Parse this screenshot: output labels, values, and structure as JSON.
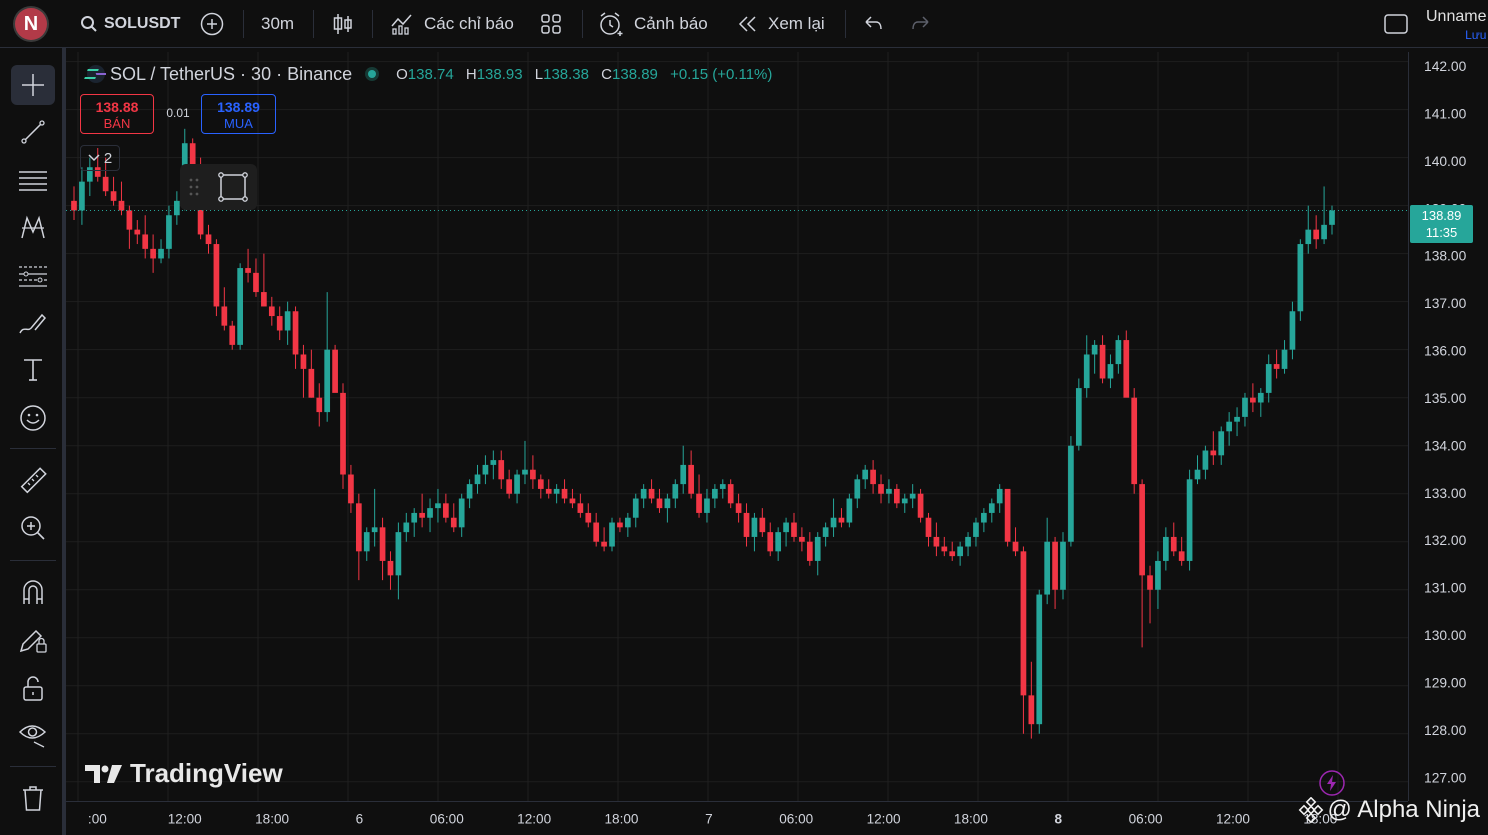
{
  "toolbar": {
    "avatar_letter": "N",
    "symbol": "SOLUSDT",
    "interval": "30m",
    "indicators_label": "Các chỉ báo",
    "alert_label": "Cảnh báo",
    "replay_label": "Xem lại",
    "layout_name": "Unname",
    "save_label": "Lưu"
  },
  "legend": {
    "title": "SOL / TetherUS · 30 · Binance",
    "o_key": "O",
    "o_val": "138.74",
    "h_key": "H",
    "h_val": "138.93",
    "l_key": "L",
    "l_val": "138.38",
    "c_key": "C",
    "c_val": "138.89",
    "change": "+0.15 (+0.11%)"
  },
  "trade": {
    "sell_price": "138.88",
    "sell_label": "BÁN",
    "spread": "0.01",
    "buy_price": "138.89",
    "buy_label": "MUA",
    "indicator_count": "2"
  },
  "current_price": {
    "price": "138.89",
    "countdown": "11:35"
  },
  "watermark": "TradingView",
  "credit": "@ Alpha Ninja",
  "colors": {
    "up": "#26a69a",
    "down": "#f23645",
    "grid": "#1f1f1f",
    "bg": "#0f0f0f"
  },
  "chart_data": {
    "type": "candlestick",
    "title": "SOL / TetherUS · 30 · Binance",
    "ylim": [
      126.6,
      142.2
    ],
    "price_ticks": [
      142,
      141,
      140,
      139,
      138,
      137,
      136,
      135,
      134,
      133,
      132,
      131,
      130,
      129,
      128,
      127
    ],
    "price_tick_labels": [
      "142.00",
      "141.00",
      "140.00",
      "139.00",
      "138.00",
      "137.00",
      "136.00",
      "135.00",
      "134.00",
      "133.00",
      "132.00",
      "131.00",
      "130.00",
      "129.00",
      "128.00",
      "127.00"
    ],
    "time_labels": [
      ":00",
      "12:00",
      "18:00",
      "6",
      "06:00",
      "12:00",
      "18:00",
      "7",
      "06:00",
      "12:00",
      "18:00",
      "8",
      "06:00",
      "12:00",
      "18:00"
    ],
    "time_label_bold": [
      false,
      false,
      false,
      false,
      false,
      false,
      false,
      false,
      false,
      false,
      false,
      true,
      false,
      false,
      false
    ],
    "candles": [
      [
        139.1,
        139.4,
        138.7,
        138.9
      ],
      [
        138.9,
        139.8,
        138.6,
        139.5
      ],
      [
        139.5,
        140.0,
        139.2,
        139.8
      ],
      [
        139.8,
        140.2,
        139.5,
        139.6
      ],
      [
        139.6,
        140.0,
        139.2,
        139.3
      ],
      [
        139.3,
        139.6,
        139.0,
        139.1
      ],
      [
        139.1,
        139.5,
        138.8,
        138.9
      ],
      [
        138.9,
        139.0,
        138.1,
        138.5
      ],
      [
        138.5,
        138.7,
        138.2,
        138.4
      ],
      [
        138.4,
        138.8,
        137.9,
        138.1
      ],
      [
        138.1,
        138.4,
        137.6,
        137.9
      ],
      [
        137.9,
        138.3,
        137.8,
        138.1
      ],
      [
        138.1,
        139.0,
        137.9,
        138.8
      ],
      [
        138.8,
        139.3,
        138.6,
        139.1
      ],
      [
        139.1,
        140.6,
        138.9,
        140.3
      ],
      [
        140.3,
        140.4,
        139.6,
        139.8
      ],
      [
        139.8,
        140.0,
        138.3,
        138.4
      ],
      [
        138.4,
        138.6,
        138.0,
        138.2
      ],
      [
        138.2,
        138.3,
        136.7,
        136.9
      ],
      [
        136.9,
        137.3,
        136.4,
        136.5
      ],
      [
        136.5,
        136.6,
        136.0,
        136.1
      ],
      [
        136.1,
        137.8,
        136.0,
        137.7
      ],
      [
        137.7,
        138.1,
        137.4,
        137.6
      ],
      [
        137.6,
        137.9,
        137.1,
        137.2
      ],
      [
        137.2,
        138.0,
        136.9,
        136.9
      ],
      [
        136.9,
        137.1,
        136.5,
        136.7
      ],
      [
        136.7,
        136.9,
        136.2,
        136.4
      ],
      [
        136.4,
        137.0,
        136.1,
        136.8
      ],
      [
        136.8,
        136.9,
        135.6,
        135.9
      ],
      [
        135.9,
        136.1,
        135.0,
        135.6
      ],
      [
        135.6,
        136.0,
        135.0,
        135.0
      ],
      [
        135.0,
        135.3,
        134.4,
        134.7
      ],
      [
        134.7,
        137.2,
        134.5,
        136.0
      ],
      [
        136.0,
        136.1,
        135.3,
        135.1
      ],
      [
        135.1,
        135.3,
        133.1,
        133.4
      ],
      [
        133.4,
        133.6,
        132.6,
        132.8
      ],
      [
        132.8,
        133.0,
        131.2,
        131.8
      ],
      [
        131.8,
        132.3,
        131.6,
        132.2
      ],
      [
        132.2,
        133.1,
        131.9,
        132.3
      ],
      [
        132.3,
        132.5,
        131.2,
        131.6
      ],
      [
        131.6,
        131.8,
        131.0,
        131.3
      ],
      [
        131.3,
        132.4,
        130.8,
        132.2
      ],
      [
        132.2,
        132.6,
        132.0,
        132.4
      ],
      [
        132.4,
        132.7,
        132.1,
        132.6
      ],
      [
        132.6,
        133.0,
        132.3,
        132.5
      ],
      [
        132.5,
        132.9,
        132.2,
        132.7
      ],
      [
        132.7,
        133.1,
        132.4,
        132.8
      ],
      [
        132.8,
        133.0,
        132.4,
        132.5
      ],
      [
        132.5,
        132.8,
        132.2,
        132.3
      ],
      [
        132.3,
        133.0,
        132.1,
        132.9
      ],
      [
        132.9,
        133.3,
        132.7,
        133.2
      ],
      [
        133.2,
        133.6,
        133.0,
        133.4
      ],
      [
        133.4,
        133.8,
        133.2,
        133.6
      ],
      [
        133.6,
        133.9,
        133.3,
        133.7
      ],
      [
        133.7,
        133.9,
        133.1,
        133.3
      ],
      [
        133.3,
        133.5,
        132.9,
        133.0
      ],
      [
        133.0,
        133.5,
        132.8,
        133.4
      ],
      [
        133.4,
        134.1,
        133.2,
        133.5
      ],
      [
        133.5,
        133.8,
        133.1,
        133.3
      ],
      [
        133.3,
        133.4,
        132.9,
        133.1
      ],
      [
        133.1,
        133.3,
        132.9,
        133.0
      ],
      [
        133.0,
        133.2,
        132.8,
        133.1
      ],
      [
        133.1,
        133.3,
        132.8,
        132.9
      ],
      [
        132.9,
        133.1,
        132.7,
        132.8
      ],
      [
        132.8,
        133.0,
        132.5,
        132.6
      ],
      [
        132.6,
        132.8,
        132.3,
        132.4
      ],
      [
        132.4,
        132.6,
        131.9,
        132.0
      ],
      [
        132.0,
        132.3,
        131.8,
        131.9
      ],
      [
        131.9,
        132.5,
        131.8,
        132.4
      ],
      [
        132.4,
        132.5,
        132.2,
        132.3
      ],
      [
        132.3,
        132.6,
        132.1,
        132.5
      ],
      [
        132.5,
        133.0,
        132.3,
        132.9
      ],
      [
        132.9,
        133.2,
        132.7,
        133.1
      ],
      [
        133.1,
        133.3,
        132.8,
        132.9
      ],
      [
        132.9,
        133.1,
        132.6,
        132.7
      ],
      [
        132.7,
        133.0,
        132.4,
        132.9
      ],
      [
        132.9,
        133.3,
        132.7,
        133.2
      ],
      [
        133.2,
        134.0,
        133.0,
        133.6
      ],
      [
        133.6,
        133.9,
        132.9,
        133.0
      ],
      [
        133.0,
        133.4,
        132.5,
        132.6
      ],
      [
        132.6,
        133.1,
        132.4,
        132.9
      ],
      [
        132.9,
        133.2,
        132.7,
        133.1
      ],
      [
        133.1,
        133.3,
        132.9,
        133.2
      ],
      [
        133.2,
        133.3,
        132.7,
        132.8
      ],
      [
        132.8,
        133.0,
        132.4,
        132.6
      ],
      [
        132.6,
        132.8,
        131.9,
        132.1
      ],
      [
        132.1,
        132.6,
        131.8,
        132.5
      ],
      [
        132.5,
        132.7,
        132.1,
        132.2
      ],
      [
        132.2,
        132.4,
        131.7,
        131.8
      ],
      [
        131.8,
        132.3,
        131.6,
        132.2
      ],
      [
        132.2,
        132.5,
        131.9,
        132.4
      ],
      [
        132.4,
        132.6,
        132.0,
        132.1
      ],
      [
        132.1,
        132.3,
        131.8,
        132.0
      ],
      [
        132.0,
        132.2,
        131.5,
        131.6
      ],
      [
        131.6,
        132.2,
        131.3,
        132.1
      ],
      [
        132.1,
        132.4,
        131.9,
        132.3
      ],
      [
        132.3,
        132.9,
        132.1,
        132.5
      ],
      [
        132.5,
        132.7,
        132.3,
        132.4
      ],
      [
        132.4,
        133.0,
        132.3,
        132.9
      ],
      [
        132.9,
        133.4,
        132.7,
        133.3
      ],
      [
        133.3,
        133.6,
        133.1,
        133.5
      ],
      [
        133.5,
        133.7,
        133.0,
        133.2
      ],
      [
        133.2,
        133.4,
        132.8,
        133.0
      ],
      [
        133.0,
        133.3,
        132.8,
        133.1
      ],
      [
        133.1,
        133.2,
        132.7,
        132.8
      ],
      [
        132.8,
        133.0,
        132.6,
        132.9
      ],
      [
        132.9,
        133.2,
        132.7,
        133.0
      ],
      [
        133.0,
        133.1,
        132.4,
        132.5
      ],
      [
        132.5,
        132.6,
        131.9,
        132.1
      ],
      [
        132.1,
        132.4,
        131.7,
        131.9
      ],
      [
        131.9,
        132.1,
        131.7,
        131.8
      ],
      [
        131.8,
        132.0,
        131.6,
        131.7
      ],
      [
        131.7,
        132.0,
        131.5,
        131.9
      ],
      [
        131.9,
        132.2,
        131.7,
        132.1
      ],
      [
        132.1,
        132.5,
        131.9,
        132.4
      ],
      [
        132.4,
        132.7,
        132.2,
        132.6
      ],
      [
        132.6,
        132.9,
        132.4,
        132.8
      ],
      [
        132.8,
        133.2,
        132.6,
        133.1
      ],
      [
        133.1,
        133.0,
        131.9,
        132.0
      ],
      [
        132.0,
        132.3,
        131.7,
        131.8
      ],
      [
        131.8,
        131.9,
        128.0,
        128.8
      ],
      [
        128.8,
        129.5,
        127.9,
        128.2
      ],
      [
        128.2,
        131.0,
        128.0,
        130.9
      ],
      [
        130.9,
        132.5,
        130.7,
        132.0
      ],
      [
        132.0,
        132.1,
        130.6,
        131.0
      ],
      [
        131.0,
        132.2,
        130.8,
        132.0
      ],
      [
        132.0,
        134.2,
        131.9,
        134.0
      ],
      [
        134.0,
        135.4,
        133.9,
        135.2
      ],
      [
        135.2,
        136.3,
        135.0,
        135.9
      ],
      [
        135.9,
        136.2,
        135.5,
        136.1
      ],
      [
        136.1,
        136.3,
        135.3,
        135.4
      ],
      [
        135.4,
        135.9,
        135.2,
        135.7
      ],
      [
        135.7,
        136.3,
        135.5,
        136.2
      ],
      [
        136.2,
        136.4,
        135.8,
        135.0
      ],
      [
        135.0,
        135.2,
        133.0,
        133.2
      ],
      [
        133.2,
        133.3,
        129.8,
        131.3
      ],
      [
        131.3,
        131.5,
        130.3,
        131.0
      ],
      [
        131.0,
        131.8,
        130.6,
        131.6
      ],
      [
        131.6,
        132.3,
        131.4,
        132.1
      ],
      [
        132.1,
        132.4,
        131.7,
        131.8
      ],
      [
        131.8,
        132.1,
        131.5,
        131.6
      ],
      [
        131.6,
        133.5,
        131.4,
        133.3
      ],
      [
        133.3,
        133.8,
        133.2,
        133.5
      ],
      [
        133.5,
        134.0,
        133.3,
        133.9
      ],
      [
        133.9,
        134.3,
        133.6,
        133.8
      ],
      [
        133.8,
        134.4,
        133.6,
        134.3
      ],
      [
        134.3,
        134.7,
        134.0,
        134.5
      ],
      [
        134.5,
        134.8,
        134.2,
        134.6
      ],
      [
        134.6,
        135.1,
        134.4,
        135.0
      ],
      [
        135.0,
        135.3,
        134.7,
        134.9
      ],
      [
        134.9,
        135.2,
        134.6,
        135.1
      ],
      [
        135.1,
        135.9,
        134.9,
        135.7
      ],
      [
        135.7,
        136.0,
        135.4,
        135.6
      ],
      [
        135.6,
        136.2,
        135.5,
        136.0
      ],
      [
        136.0,
        137.0,
        135.8,
        136.8
      ],
      [
        136.8,
        138.3,
        136.6,
        138.2
      ],
      [
        138.2,
        139.0,
        138.0,
        138.5
      ],
      [
        138.5,
        138.8,
        138.1,
        138.3
      ],
      [
        138.3,
        139.4,
        138.2,
        138.6
      ],
      [
        138.6,
        139.0,
        138.4,
        138.9
      ]
    ]
  }
}
